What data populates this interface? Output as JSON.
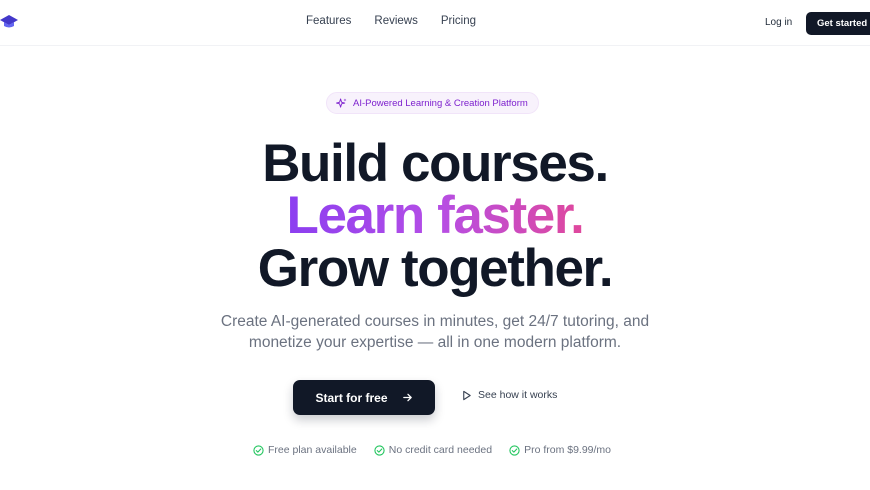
{
  "nav": {
    "logo_icon": "graduation-cap-icon",
    "links": [
      {
        "label": "Features"
      },
      {
        "label": "Reviews"
      },
      {
        "label": "Pricing"
      }
    ],
    "login_label": "Log in",
    "cta_label": "Get started"
  },
  "hero": {
    "badge": {
      "icon": "sparkles-icon",
      "text": "AI-Powered Learning & Creation Platform"
    },
    "headline_line1": "Build courses.",
    "headline_line2": "Learn faster.",
    "headline_line3": "Grow together.",
    "subtitle_line1": "Create AI-generated courses in minutes, get 24/7 tutoring, and",
    "subtitle_line2": "monetize your expertise — all in one modern platform.",
    "primary_cta": {
      "label": "Start for free",
      "icon": "arrow-right-icon"
    },
    "secondary_cta": {
      "label": "See how it works",
      "icon": "play-icon"
    },
    "perks": [
      {
        "icon": "check-circle-icon",
        "text": "Free plan available"
      },
      {
        "icon": "check-circle-icon",
        "text": "No credit card needed"
      },
      {
        "icon": "check-circle-icon",
        "text": "Pro from $9.99/mo"
      }
    ]
  },
  "colors": {
    "primary_dark": "#111827",
    "gradient_start": "#8b3ef0",
    "gradient_end": "#e0489c",
    "badge_text": "#7e22ce",
    "check_green": "#22c55e"
  }
}
